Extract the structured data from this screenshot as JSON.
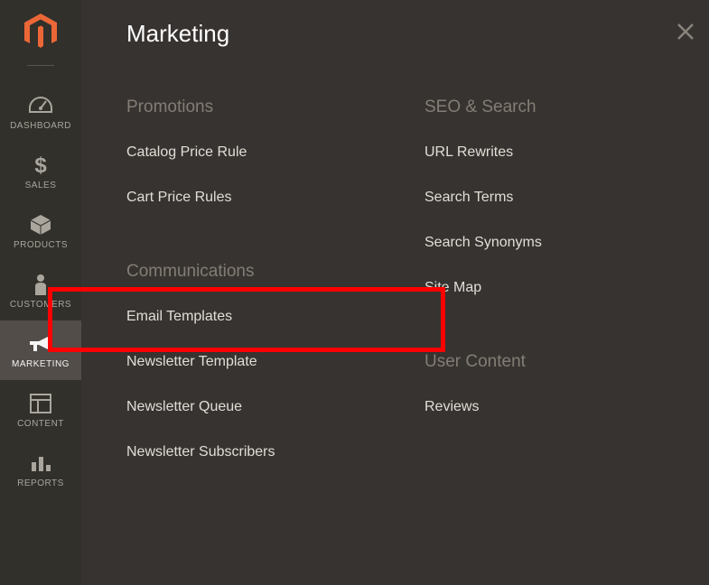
{
  "sidebar": {
    "items": [
      {
        "label": "DASHBOARD"
      },
      {
        "label": "SALES"
      },
      {
        "label": "PRODUCTS"
      },
      {
        "label": "CUSTOMERS"
      },
      {
        "label": "MARKETING"
      },
      {
        "label": "CONTENT"
      },
      {
        "label": "REPORTS"
      }
    ]
  },
  "panel": {
    "title": "Marketing",
    "columns": [
      {
        "groups": [
          {
            "title": "Promotions",
            "links": [
              {
                "label": "Catalog Price Rule"
              },
              {
                "label": "Cart Price Rules"
              }
            ]
          },
          {
            "title": "Communications",
            "links": [
              {
                "label": "Email Templates",
                "highlighted": true
              },
              {
                "label": "Newsletter Template"
              },
              {
                "label": "Newsletter Queue"
              },
              {
                "label": "Newsletter Subscribers"
              }
            ]
          }
        ]
      },
      {
        "groups": [
          {
            "title": "SEO & Search",
            "links": [
              {
                "label": "URL Rewrites"
              },
              {
                "label": "Search Terms"
              },
              {
                "label": "Search Synonyms"
              },
              {
                "label": "Site Map"
              }
            ]
          },
          {
            "title": "User Content",
            "links": [
              {
                "label": "Reviews"
              }
            ]
          }
        ]
      }
    ]
  }
}
